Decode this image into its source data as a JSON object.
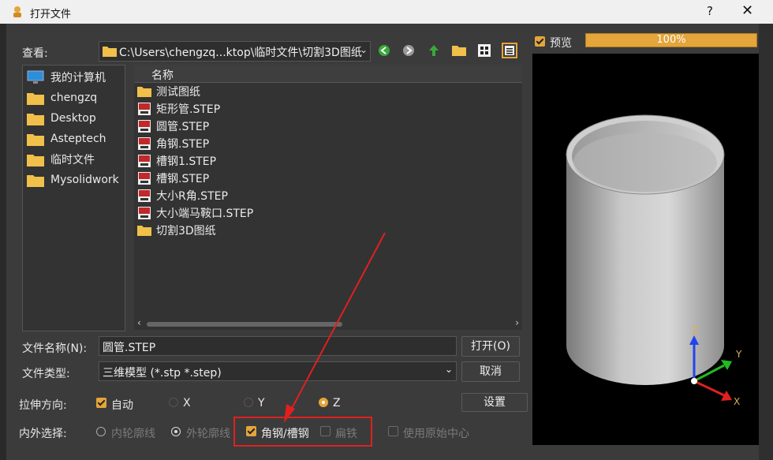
{
  "window": {
    "title": "打开文件",
    "help": "?",
    "close": "✕"
  },
  "lookin": {
    "label": "查看:",
    "path": "C:\\Users\\chengzq...ktop\\临时文件\\切割3D图纸"
  },
  "preview": {
    "label": "预览",
    "checked": true,
    "progress_text": "100%",
    "progress_value": 100
  },
  "places": [
    "我的计算机",
    "chengzq",
    "Desktop",
    "Asteptech",
    "临时文件",
    "Mysolidwork"
  ],
  "files": {
    "column": "名称",
    "items": [
      {
        "name": "测试图纸",
        "type": "folder"
      },
      {
        "name": "矩形管.STEP",
        "type": "step"
      },
      {
        "name": "圆管.STEP",
        "type": "step"
      },
      {
        "name": "角钢.STEP",
        "type": "step"
      },
      {
        "name": "槽钢1.STEP",
        "type": "step"
      },
      {
        "name": "槽钢.STEP",
        "type": "step"
      },
      {
        "name": "大小R角.STEP",
        "type": "step"
      },
      {
        "name": "大小端马鞍口.STEP",
        "type": "step"
      },
      {
        "name": "切割3D图纸",
        "type": "folder"
      }
    ]
  },
  "filename": {
    "label": "文件名称(N):",
    "value": "圆管.STEP"
  },
  "filetype": {
    "label": "文件类型:",
    "value": "三维模型 (*.stp *.step)"
  },
  "buttons": {
    "open": "打开(O)",
    "cancel": "取消",
    "settings": "设置"
  },
  "extrude": {
    "label": "拉伸方向:",
    "auto": "自动",
    "x": "X",
    "y": "Y",
    "z": "Z"
  },
  "inout": {
    "label": "内外选择:",
    "inner": "内轮廓线",
    "outer": "外轮廓线",
    "angle": "角钢/槽钢",
    "flat": "扁铁",
    "origin": "使用原始中心"
  },
  "axes": {
    "x": "X",
    "y": "Y",
    "z": "Z"
  },
  "colors": {
    "accent": "#e4a53a",
    "axis_x": "#e02020",
    "axis_y": "#22bb22",
    "axis_z": "#2244ee",
    "highlight": "#e02020"
  }
}
